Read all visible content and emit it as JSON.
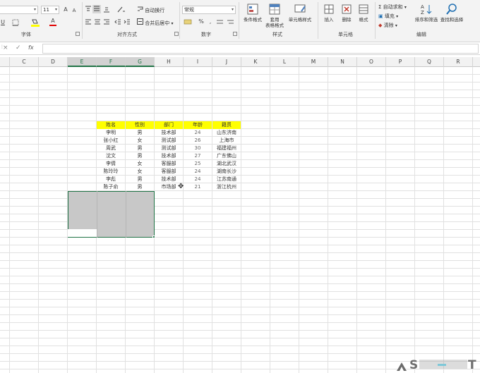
{
  "ribbon": {
    "font": {
      "size_value": "11",
      "grow_label": "A",
      "shrink_label": "A",
      "underline_label": "U",
      "font_color_label": "A",
      "group_label": "字体"
    },
    "alignment": {
      "wrap_text_label": "自动换行",
      "merge_center_label": "合并后居中",
      "group_label": "对齐方式"
    },
    "number": {
      "format_value": "常规",
      "percent_label": "%",
      "group_label": "数字"
    },
    "styles": {
      "conditional_formatting_label": "条件格式",
      "format_as_table_line1": "套用",
      "format_as_table_line2": "表格格式",
      "cell_styles_label": "单元格样式",
      "group_label": "样式"
    },
    "cells": {
      "insert_label": "插入",
      "delete_label": "删除",
      "format_label": "格式",
      "group_label": "单元格"
    },
    "editing": {
      "autosum_label": "自动求和",
      "fill_label": "填充",
      "clear_label": "清除",
      "sort_filter_label": "排序和筛选",
      "find_select_label": "查找和选择",
      "group_label": "编辑"
    }
  },
  "formula_bar": {
    "cancel_label": "×",
    "enter_label": "✓",
    "fx_label": "fx"
  },
  "columns": [
    "C",
    "D",
    "E",
    "F",
    "G",
    "H",
    "I",
    "J",
    "K",
    "L",
    "M",
    "N",
    "O",
    "P",
    "Q",
    "R"
  ],
  "selected_columns": [
    "E",
    "F",
    "G"
  ],
  "table": {
    "headers": [
      "姓名",
      "性别",
      "部门",
      "年龄",
      "籍贯"
    ],
    "rows": [
      [
        "李明",
        "男",
        "技术部",
        "24",
        "山东济南"
      ],
      [
        "张小红",
        "女",
        "测试部",
        "26",
        "上海市"
      ],
      [
        "周武",
        "男",
        "测试部",
        "30",
        "福建福州"
      ],
      [
        "沈文",
        "男",
        "技术部",
        "27",
        "广东佛山"
      ],
      [
        "李倩",
        "女",
        "客服部",
        "25",
        "湖北武汉"
      ],
      [
        "陈玲玲",
        "女",
        "客服部",
        "24",
        "湖南长沙"
      ],
      [
        "李彪",
        "男",
        "技术部",
        "24",
        "江苏南通"
      ],
      [
        "陈子俞",
        "男",
        "市场部",
        "21",
        "浙江杭州"
      ]
    ]
  },
  "colors": {
    "accent": "#217346",
    "header_fill": "#ffff00",
    "selection_fill": "#c8c8c8"
  }
}
